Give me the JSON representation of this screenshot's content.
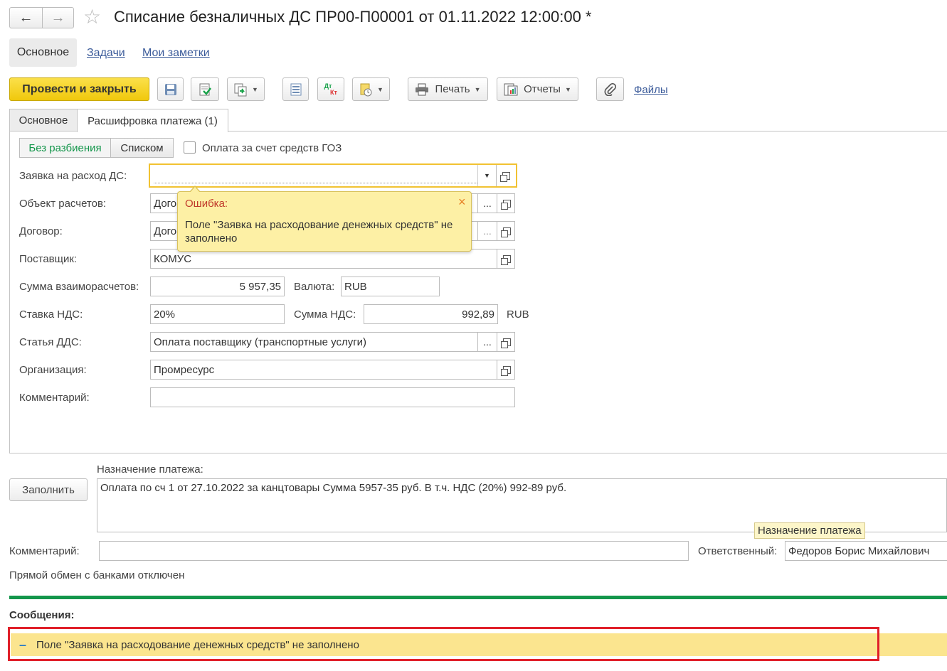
{
  "window": {
    "title": "Списание безналичных ДС ПР00-П00001 от 01.11.2022 12:00:00 *"
  },
  "nav_tabs": [
    {
      "label": "Основное"
    },
    {
      "label": "Задачи"
    },
    {
      "label": "Мои заметки"
    }
  ],
  "toolbar": {
    "post_close_label": "Провести и закрыть",
    "print_label": "Печать",
    "reports_label": "Отчеты",
    "files_label": "Файлы",
    "dtkt_top": "Дт",
    "dtkt_bottom": "Кт"
  },
  "inner_tabs": [
    {
      "label": "Основное"
    },
    {
      "label": "Расшифровка платежа (1)"
    }
  ],
  "split_mode": {
    "no_split": "Без разбиения",
    "list": "Списком",
    "goz_label": "Оплата за счет средств ГОЗ"
  },
  "form": {
    "request_label": "Заявка на расход ДС:",
    "request_value": "",
    "object_label": "Объект расчетов:",
    "object_value": "Дого",
    "contract_label": "Договор:",
    "contract_value": "Дого",
    "supplier_label": "Поставщик:",
    "supplier_value": "КОМУС",
    "sum_label": "Сумма взаиморасчетов:",
    "sum_value": "5 957,35",
    "currency_label": "Валюта:",
    "currency_value": "RUB",
    "vat_rate_label": "Ставка НДС:",
    "vat_rate_value": "20%",
    "vat_sum_label": "Сумма НДС:",
    "vat_sum_value": "992,89",
    "vat_currency": "RUB",
    "dds_label": "Статья ДДС:",
    "dds_value": "Оплата поставщику (транспортные услуги)",
    "org_label": "Организация:",
    "org_value": "Промресурс",
    "comment_label": "Комментарий:",
    "comment_value": "",
    "dots": "..."
  },
  "error_popup": {
    "title": "Ошибка:",
    "message": "Поле \"Заявка на расходование денежных средств\" не заполнено",
    "close": "×"
  },
  "purpose": {
    "label": "Назначение платежа:",
    "fill_button": "Заполнить",
    "text": "Оплата по сч 1 от 27.10.2022 за канцтовары Сумма 5957-35 руб. В т.ч. НДС (20%) 992-89 руб.",
    "tooltip": "Назначение платежа"
  },
  "footer": {
    "comment_label": "Комментарий:",
    "comment_value": "",
    "responsible_label": "Ответственный:",
    "responsible_value": "Федоров Борис Михайлович",
    "bank_status": "Прямой обмен с банками отключен"
  },
  "messages": {
    "header": "Сообщения:",
    "items": [
      {
        "text": "Поле \"Заявка на расходование денежных средств\" не заполнено",
        "marker": "–"
      }
    ]
  },
  "colors": {
    "accent_green": "#14964b",
    "primary_button": "#f5d21c",
    "error_bg": "#fdf0a5",
    "message_bg": "#fbe58f",
    "highlight_red": "#e0202a"
  }
}
